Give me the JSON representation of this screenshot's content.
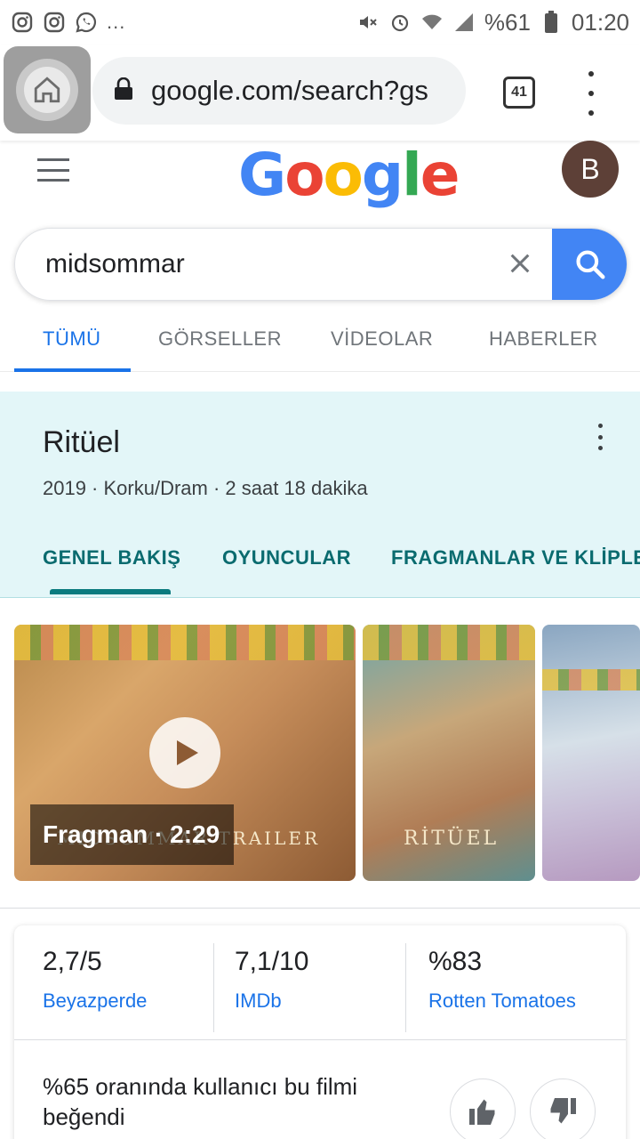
{
  "status_bar": {
    "left_icons": [
      "instagram-icon",
      "instagram-icon",
      "whatsapp-icon"
    ],
    "more": "...",
    "battery": "%61",
    "time": "01:20"
  },
  "toolbar": {
    "url": "google.com/search?gs",
    "tab_count": "41"
  },
  "google": {
    "logo": [
      "G",
      "o",
      "o",
      "g",
      "l",
      "e"
    ],
    "avatar_letter": "B"
  },
  "search": {
    "query": "midsommar"
  },
  "tabs": [
    "TÜMÜ",
    "GÖRSELLER",
    "VİDEOLAR",
    "HABERLER"
  ],
  "knowledge_panel": {
    "title": "Ritüel",
    "subtitle": "2019 · Korku/Dram · 2 saat 18 dakika",
    "tabs": [
      "GENEL BAKIŞ",
      "OYUNCULAR",
      "FRAGMANLAR VE KLİPLER"
    ]
  },
  "media": {
    "trailer_label": "Fragman · 2:29",
    "trailer_poster_text": "MIDSOMMAR TRAILER",
    "poster_text": "RİTÜEL"
  },
  "ratings": {
    "items": [
      {
        "score": "2,7/5",
        "source": "Beyazperde"
      },
      {
        "score": "7,1/10",
        "source": "IMDb"
      },
      {
        "score": "%83",
        "source": "Rotten Tomatoes"
      }
    ],
    "liked_text": "%65 oranında kullanıcı bu filmi beğendi"
  },
  "colors": {
    "accent": "#1a73e8",
    "panel_bg": "#e3f6f8",
    "panel_tab": "#0a6b6f",
    "avatar_bg": "#5d4037"
  }
}
